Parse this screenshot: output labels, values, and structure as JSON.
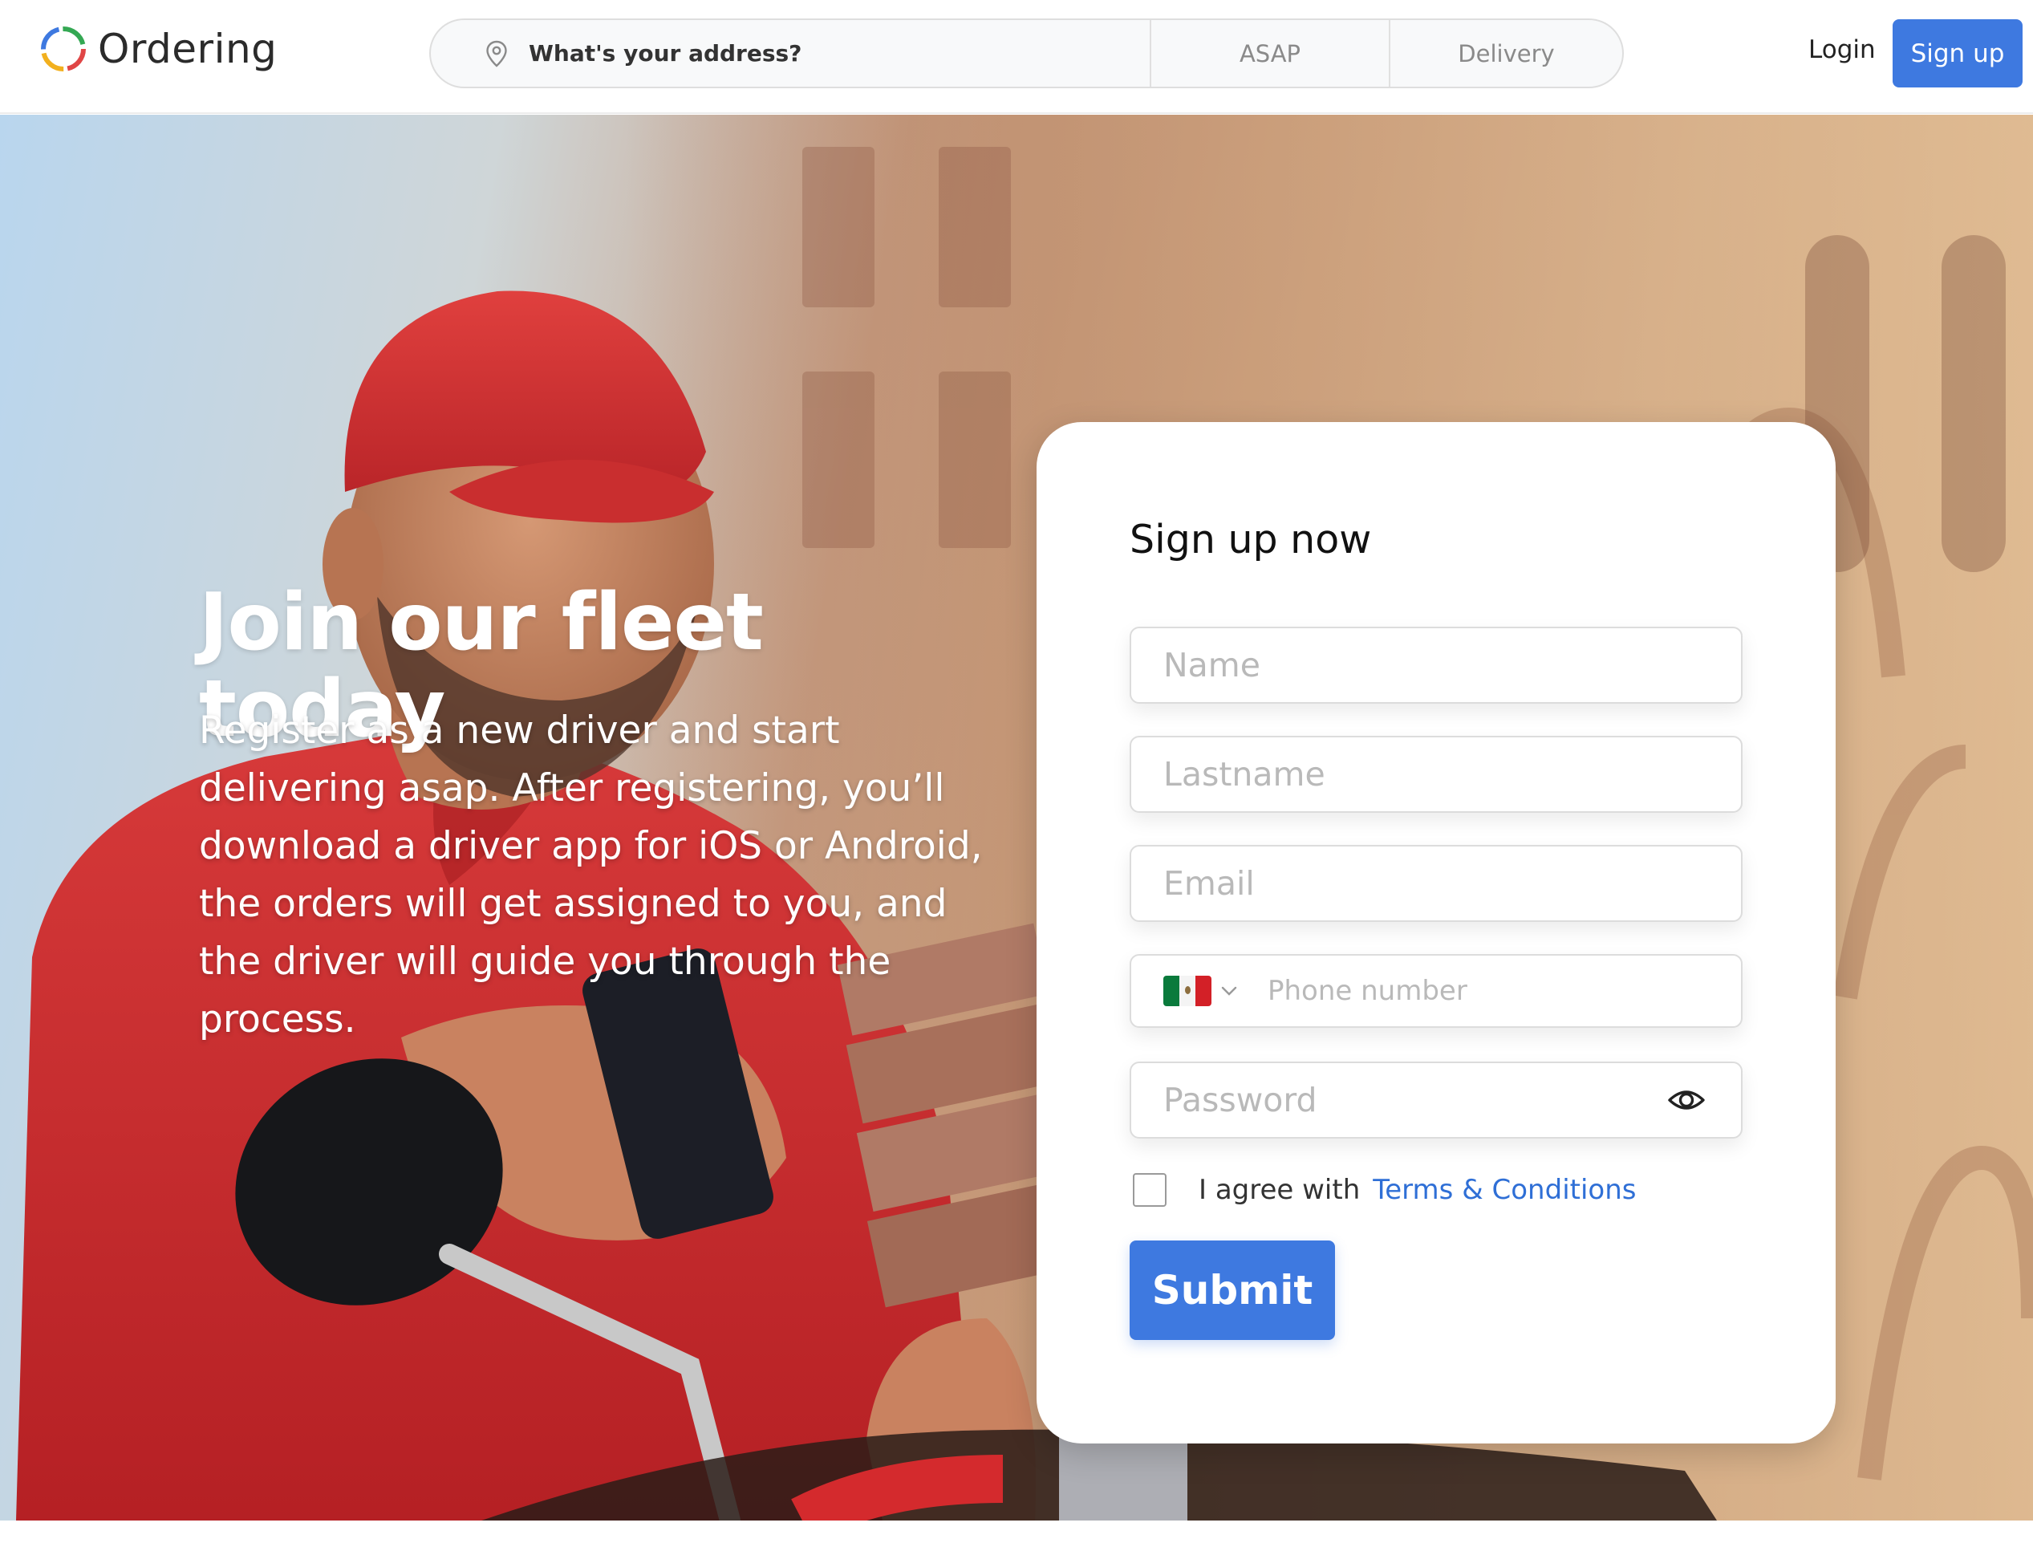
{
  "header": {
    "logo_text": "Ordering",
    "address_placeholder": "What's your address?",
    "time_option": "ASAP",
    "order_type": "Delivery",
    "login_label": "Login",
    "signup_label": "Sign up"
  },
  "hero": {
    "title": "Join our fleet today",
    "description": "Register as a new driver and start delivering asap. After registering, you’ll download a driver app for iOS or Android, the orders will get assigned to you, and the driver will guide you through the process."
  },
  "form": {
    "title": "Sign up now",
    "name_placeholder": "Name",
    "lastname_placeholder": "Lastname",
    "email_placeholder": "Email",
    "phone_placeholder": "Phone number",
    "password_placeholder": "Password",
    "agree_text": "I agree with",
    "terms_label": "Terms & Conditions",
    "submit_label": "Submit",
    "country_flag": "mexico-flag-icon"
  },
  "colors": {
    "brand_blue": "#3e79e0",
    "link_blue": "#2f6fd6",
    "shirt_red": "#c8282c"
  }
}
